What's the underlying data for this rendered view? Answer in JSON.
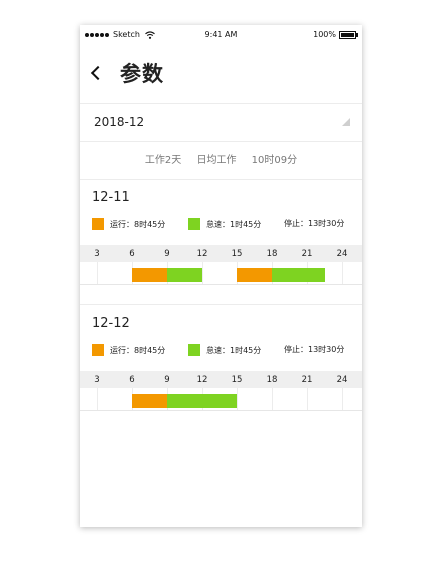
{
  "status_bar": {
    "carrier": "Sketch",
    "time": "9:41 AM",
    "battery": "100%"
  },
  "nav": {
    "title": "参数"
  },
  "date_selector": {
    "value": "2018-12"
  },
  "summary": {
    "work_days": "工作2天",
    "daily_label": "日均工作",
    "daily_value": "10时09分"
  },
  "colors": {
    "running": "#F39800",
    "idle": "#7ED321"
  },
  "axis_ticks": [
    "3",
    "6",
    "9",
    "12",
    "15",
    "18",
    "21",
    "24"
  ],
  "days": [
    {
      "date": "12-11",
      "running": "运行：8时45分",
      "idle": "怠速：1时45分",
      "stopped": "停止：13时30分",
      "segments": [
        {
          "state": "running",
          "start": 6,
          "end": 9
        },
        {
          "state": "idle",
          "start": 9,
          "end": 12
        },
        {
          "state": "running",
          "start": 15,
          "end": 18
        },
        {
          "state": "idle",
          "start": 18,
          "end": 22.5
        }
      ]
    },
    {
      "date": "12-12",
      "running": "运行：8时45分",
      "idle": "怠速：1时45分",
      "stopped": "停止：13时30分",
      "segments": [
        {
          "state": "running",
          "start": 6,
          "end": 9
        },
        {
          "state": "idle",
          "start": 9,
          "end": 15
        }
      ]
    }
  ]
}
